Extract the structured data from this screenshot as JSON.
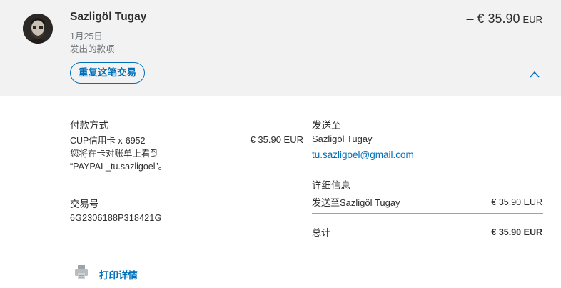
{
  "header": {
    "name": "Sazligöl Tugay",
    "date": "1月25日",
    "type": "发出的款项",
    "amount": "– € 35.90",
    "currency": "EUR",
    "repeat_button": "重复这笔交易"
  },
  "payment": {
    "heading": "付款方式",
    "card": "CUP信用卡 x-6952",
    "amount": "€ 35.90 EUR",
    "note_line1": "您将在卡对账单上看到",
    "note_line2": "“PAYPAL_tu.sazligoel”。"
  },
  "transaction": {
    "heading": "交易号",
    "id": "6G2306188P318421G"
  },
  "sent_to": {
    "heading": "发送至",
    "name": "Sazligöl Tugay",
    "email": "tu.sazligoel@gmail.com"
  },
  "details": {
    "heading": "详细信息",
    "line_label": "发送至Sazligöl Tugay",
    "line_amount": "€ 35.90 EUR",
    "total_label": "总计",
    "total_amount": "€ 35.90 EUR"
  },
  "print": {
    "label": "打印详情"
  },
  "colors": {
    "accent": "#0070ba",
    "header_bg": "#f2f2f2"
  },
  "icons": [
    "avatar",
    "chevron-up-icon",
    "printer-icon"
  ]
}
